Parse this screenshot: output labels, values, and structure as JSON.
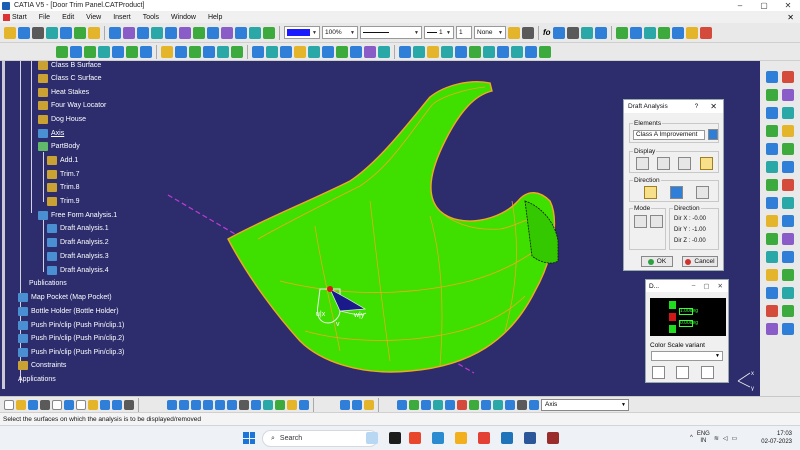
{
  "window": {
    "title": "CATIA V5 - [Door Trim Panel.CATProduct]",
    "min": "–",
    "max": "▢",
    "close": "✕"
  },
  "menu": [
    "Start",
    "File",
    "Edit",
    "View",
    "Insert",
    "Tools",
    "Window",
    "Help"
  ],
  "menu_close": "✕",
  "toolbar": {
    "zoom": "100%",
    "line_weight": "1",
    "layer_num": "1",
    "layer": "None",
    "fo": "fo"
  },
  "tree": {
    "items": [
      {
        "label": "Class B Surface",
        "icon": "gear-icon"
      },
      {
        "label": "Class C Surface",
        "icon": "gear-icon"
      },
      {
        "label": "Heat Stakes",
        "icon": "gear-icon"
      },
      {
        "label": "Four Way Locator",
        "icon": "gear-icon"
      },
      {
        "label": "Dog House",
        "icon": "gear-icon"
      },
      {
        "label": "Axis",
        "icon": "axis-icon"
      },
      {
        "label": "PartBody",
        "icon": "partbody-icon"
      },
      {
        "label": "Add.1",
        "icon": "surface-icon"
      },
      {
        "label": "Trim.7",
        "icon": "surface-icon"
      },
      {
        "label": "Trim.8",
        "icon": "surface-icon"
      },
      {
        "label": "Trim.9",
        "icon": "surface-icon"
      },
      {
        "label": "Free Form Analysis.1",
        "icon": "analysis-icon"
      },
      {
        "label": "Draft Analysis.1",
        "icon": "draft-analysis-icon"
      },
      {
        "label": "Draft Analysis.2",
        "icon": "draft-analysis-icon"
      },
      {
        "label": "Draft Analysis.3",
        "icon": "draft-analysis-icon"
      },
      {
        "label": "Draft Analysis.4",
        "icon": "draft-analysis-icon"
      },
      {
        "label": "Publications",
        "icon": ""
      },
      {
        "label": "Map Pocket (Map Pocket)",
        "icon": "part-icon"
      },
      {
        "label": "Bottle Holder (Bottle Holder)",
        "icon": "part-icon"
      },
      {
        "label": "Push Pin/clip (Push Pin/clip.1)",
        "icon": "part-icon"
      },
      {
        "label": "Push Pin/clip (Push Pin/clip.2)",
        "icon": "part-icon"
      },
      {
        "label": "Push Pin/clip (Push Pin/clip.3)",
        "icon": "part-icon"
      },
      {
        "label": "Constraints",
        "icon": "constraints-icon"
      },
      {
        "label": "Applications",
        "icon": ""
      }
    ]
  },
  "viewport": {
    "bg": "#2d2d6e",
    "part_color": "#39e600",
    "edge_color": "#f5a623",
    "labels": {
      "u": "u|x",
      "v": "v",
      "w": "w|y"
    },
    "compass": {
      "x": "x",
      "y": "y"
    }
  },
  "draft_dialog": {
    "title": "Draft Analysis",
    "help": "?",
    "close": "✕",
    "elements_label": "Elements",
    "elements_value": "Class A Improvement",
    "display_label": "Display",
    "direction_label": "Direction",
    "mode_label": "Mode",
    "direction_info_label": "Direction",
    "dir_x": "Dir X :  -0.00",
    "dir_y": "Dir Y :  -1.00",
    "dir_z": "Dir Z :  -0.00",
    "ok": "OK",
    "cancel": "Cancel"
  },
  "scale_dialog": {
    "title": "D...",
    "variant_label": "Color Scale variant",
    "swatch_labels": [
      "1.00deg",
      "0.00deg"
    ]
  },
  "bottom": {
    "command_value": "Axis"
  },
  "status": {
    "message": "Select the surfaces on which the analysis is to be displayed/removed"
  },
  "taskbar": {
    "search": "Search",
    "lang1": "ENG",
    "lang2": "IN",
    "time": "17:03",
    "date": "02-07-2023"
  },
  "colors": {
    "accent_blue": "#1c73d8",
    "green_ok": "#2ea043",
    "red_cancel": "#d0312d"
  }
}
